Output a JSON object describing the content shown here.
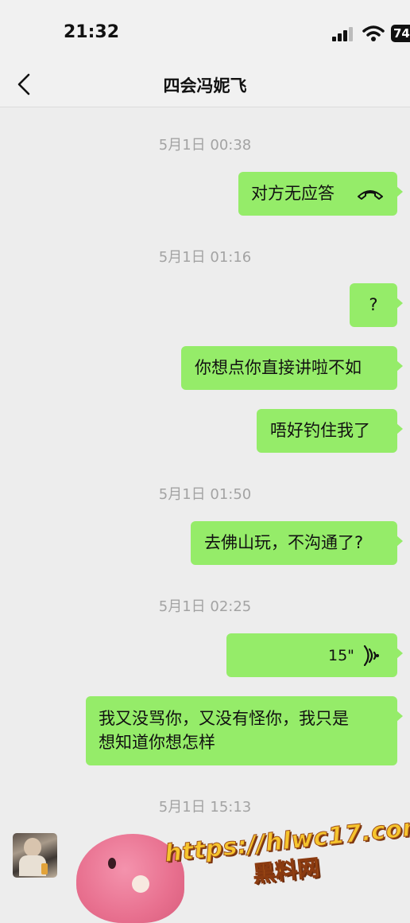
{
  "status_bar": {
    "time": "21:32",
    "battery": "74"
  },
  "header": {
    "title": "四会冯妮飞"
  },
  "messages": {
    "ts1": "5月1日 00:38",
    "m1": "对方无应答",
    "ts2": "5月1日 01:16",
    "m2": "?",
    "m3": "你想点你直接讲啦不如",
    "m4": "唔好钓住我了",
    "ts3": "5月1日 01:50",
    "m5": "去佛山玩，不沟通了?",
    "ts4": "5月1日 02:25",
    "m6_duration": "15\"",
    "m7_line1": "我又没骂你，又没有怪你，我只是",
    "m7_line2": "想知道你想怎样",
    "ts5": "5月1日 15:13"
  },
  "watermark": {
    "url": "https://hlwc17.com",
    "label": "黑料网"
  },
  "icons": {
    "back": "chevron-left-icon",
    "call": "phone-hangup-icon",
    "voice": "voice-wave-icon"
  },
  "colors": {
    "bubble": "#95ec69",
    "background": "#ededed",
    "timestamp": "#a3a3a3"
  }
}
